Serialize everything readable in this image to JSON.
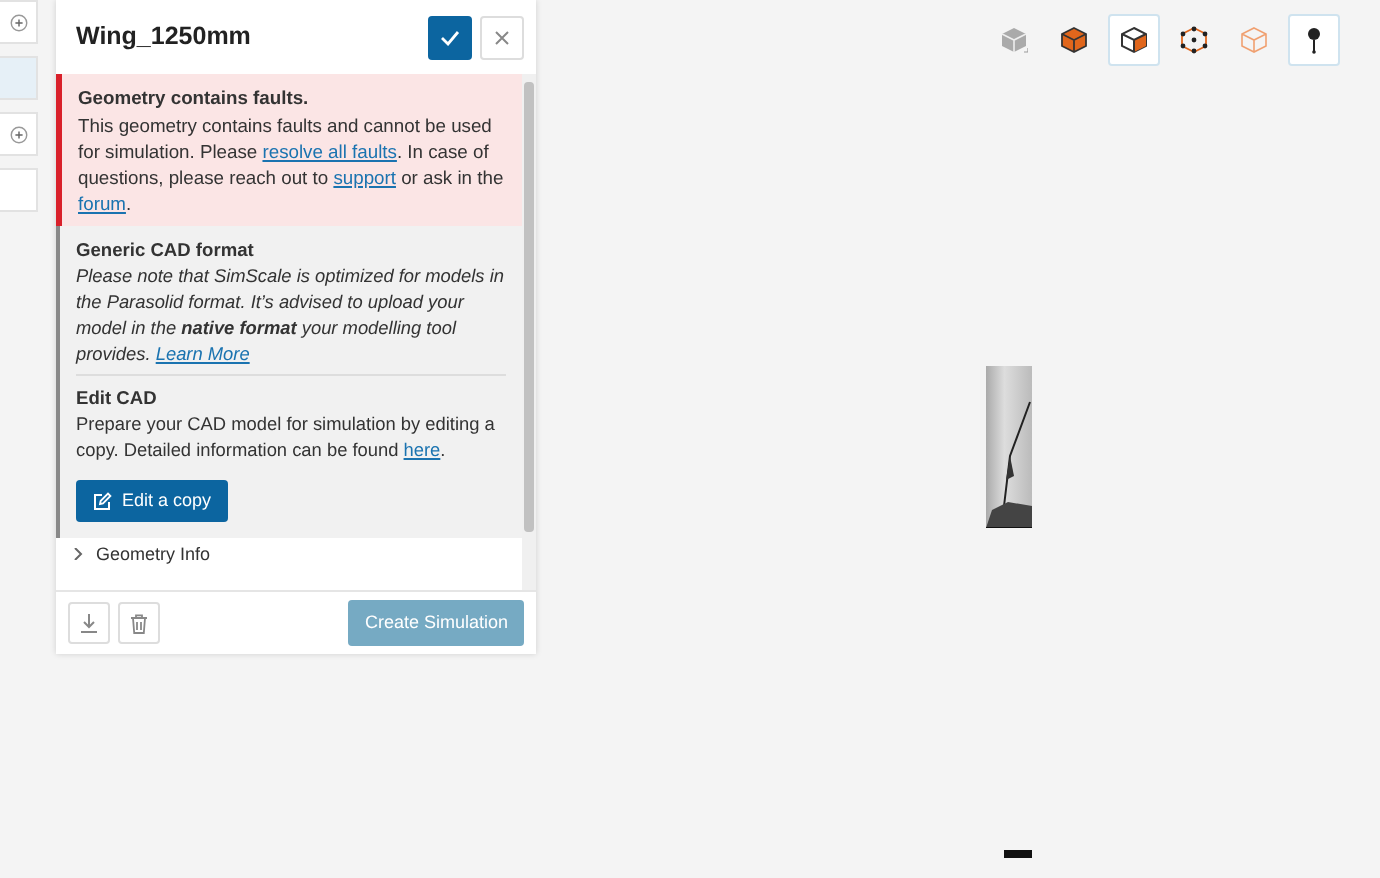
{
  "left_strip": [
    {
      "kind": "add",
      "selected": false
    },
    {
      "kind": "blank",
      "selected": true
    },
    {
      "kind": "add",
      "selected": false
    },
    {
      "kind": "blank",
      "selected": false
    }
  ],
  "panel": {
    "title": "Wing_1250mm",
    "alert": {
      "title": "Geometry contains faults.",
      "parts": [
        {
          "kind": "text",
          "text": "This geometry contains faults and cannot be used for simulation. Please "
        },
        {
          "kind": "link",
          "text": "resolve all faults"
        },
        {
          "kind": "text",
          "text": ". In case of questions, please reach out to "
        },
        {
          "kind": "link",
          "text": "support"
        },
        {
          "kind": "text",
          "text": " or ask in the "
        },
        {
          "kind": "link",
          "text": "forum"
        },
        {
          "kind": "text",
          "text": "."
        }
      ]
    },
    "notice": {
      "title": "Generic CAD format",
      "text": "Please note that SimScale is optimized for models in the Parasolid format. It’s advised to upload your model in the **native format** your modelling tool provides.",
      "link": "Learn More"
    },
    "edit": {
      "title": "Edit CAD",
      "text": "Prepare your CAD model for simulation by editing a copy. Detailed information can be found ",
      "link": "here",
      "tail": ".",
      "button": "Edit a copy"
    },
    "section": {
      "label": "Geometry Info",
      "expanded": false
    },
    "footer": {
      "primary": "Create Simulation",
      "primary_disabled": true
    }
  },
  "toolbar": [
    {
      "kind": "solid-grey",
      "selected": false
    },
    {
      "kind": "solid-orange",
      "selected": false
    },
    {
      "kind": "half",
      "selected": true
    },
    {
      "kind": "vertices",
      "selected": false
    },
    {
      "kind": "outline",
      "selected": false
    },
    {
      "kind": "pin",
      "selected": true
    }
  ]
}
